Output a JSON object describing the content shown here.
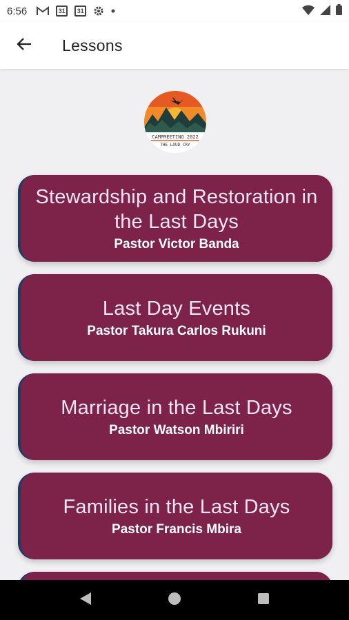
{
  "status_bar": {
    "time": "6:56",
    "icons": [
      "gmail-icon",
      "calendar-icon",
      "calendar-icon",
      "settings-icon",
      "dot-icon"
    ],
    "calendar_day": "31",
    "right_icons": [
      "wifi-icon",
      "signal-icon",
      "battery-icon"
    ]
  },
  "app_bar": {
    "back_icon": "arrow-left-icon",
    "title": "Lessons"
  },
  "logo": {
    "line1": "CAMPMEETING 2022",
    "line2": "THE LOUD CRY"
  },
  "colors": {
    "card": "#7d2249",
    "card_edge": "#1e3a5f",
    "background": "#f0f0f2"
  },
  "lessons": [
    {
      "title": "Stewardship and Restoration in the Last Days",
      "speaker": "Pastor Victor Banda"
    },
    {
      "title": "Last Day Events",
      "speaker": "Pastor Takura Carlos Rukuni"
    },
    {
      "title": "Marriage in the Last Days",
      "speaker": "Pastor Watson Mbiriri"
    },
    {
      "title": "Families in the Last Days",
      "speaker": "Pastor Francis Mbira"
    }
  ],
  "nav_bar": {
    "icons": [
      "back-triangle-icon",
      "home-circle-icon",
      "recents-square-icon"
    ]
  }
}
